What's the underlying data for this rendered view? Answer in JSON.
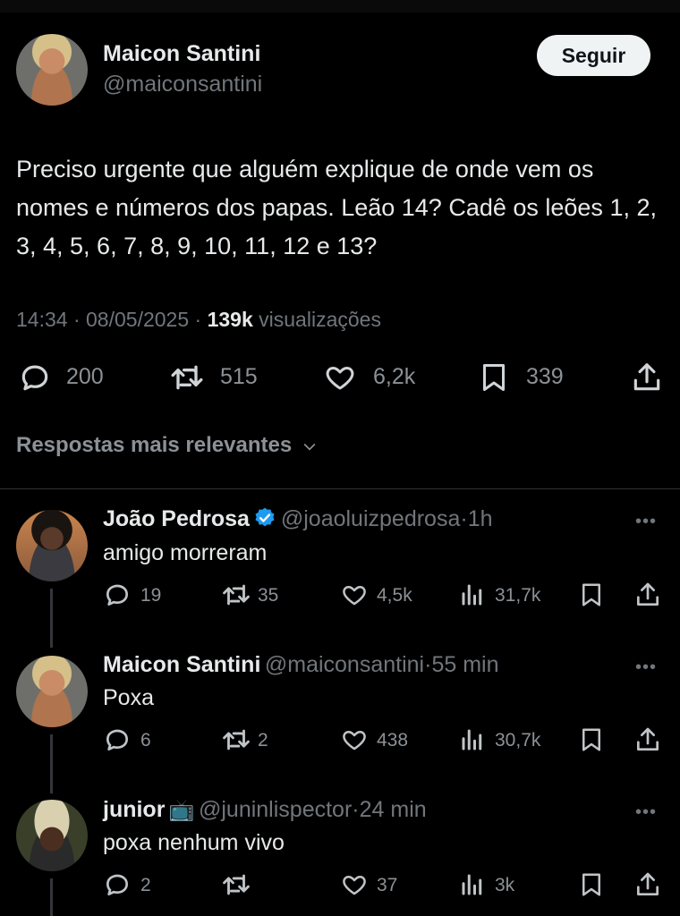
{
  "tweet": {
    "author_name": "Maicon Santini",
    "author_handle": "@maiconsantini",
    "follow_label": "Seguir",
    "text": "Preciso urgente que alguém explique de onde vem os nomes e números dos papas. Leão 14? Cadê os leões 1, 2, 3, 4, 5, 6, 7, 8, 9, 10, 11, 12 e 13?",
    "time": "14:34",
    "date": "08/05/2025",
    "views_count": "139k",
    "views_label": "visualizações",
    "replies": "200",
    "retweets": "515",
    "likes": "6,2k",
    "bookmarks": "339"
  },
  "replies_sort": {
    "label": "Respostas mais relevantes"
  },
  "replies": [
    {
      "name": "João Pedrosa",
      "verified": true,
      "handle": "@joaoluizpedrosa",
      "time": "1h",
      "text": "amigo morreram",
      "replies": "19",
      "retweets": "35",
      "likes": "4,5k",
      "views": "31,7k"
    },
    {
      "name": "Maicon Santini",
      "handle": "@maiconsantini",
      "time": "55 min",
      "text": "Poxa",
      "replies": "6",
      "retweets": "2",
      "likes": "438",
      "views": "30,7k"
    },
    {
      "name": "junior",
      "emoji": "📺",
      "handle": "@juninlispector",
      "time": "24 min",
      "text": "poxa nenhum vivo",
      "replies": "2",
      "retweets": "",
      "likes": "37",
      "views": "3k"
    }
  ],
  "colors": {
    "background": "#000000",
    "verified": "#1d9bf0",
    "muted": "#71767b"
  },
  "separator": "·",
  "more_glyph": "•••"
}
